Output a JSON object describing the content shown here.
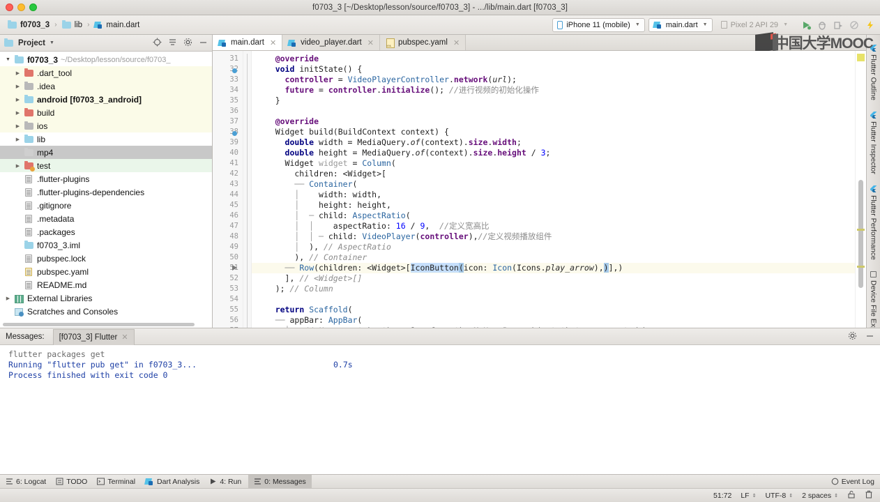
{
  "window": {
    "title": "f0703_3 [~/Desktop/lesson/source/f0703_3] - .../lib/main.dart [f0703_3]"
  },
  "toolbar": {
    "breadcrumbs": [
      {
        "label": "f0703_3",
        "icon": "project-icon"
      },
      {
        "label": "lib",
        "icon": "folder-icon"
      },
      {
        "label": "main.dart",
        "icon": "dart-file-icon"
      }
    ],
    "breadcrumb_separator": "›",
    "device_selector": "iPhone 11 (mobile)",
    "run_config": "main.dart",
    "android_device": "Pixel 2 API 29",
    "icons": [
      "run-icon",
      "debug-icon",
      "profile-icon",
      "coverage-icon",
      "hot-reload-icon"
    ]
  },
  "watermark": {
    "text": "中国大学MOOC"
  },
  "project_panel": {
    "title": "Project",
    "header_icons": [
      "locate-icon",
      "collapse-all-icon",
      "settings-gear-icon",
      "minimize-icon"
    ],
    "tree": [
      {
        "label": "f0703_3",
        "path": "~/Desktop/lesson/source/f0703_",
        "indent": 0,
        "arrow": "open",
        "icon": "project-folder-icon",
        "bold": true,
        "bg": "none"
      },
      {
        "label": ".dart_tool",
        "indent": 1,
        "arrow": "closed",
        "icon": "folder-red-icon",
        "bg": "yellow"
      },
      {
        "label": ".idea",
        "indent": 1,
        "arrow": "closed",
        "icon": "folder-gray-icon",
        "bg": "yellow"
      },
      {
        "label": "android [f0703_3_android]",
        "indent": 1,
        "arrow": "closed",
        "icon": "module-folder-icon",
        "bold": true,
        "bg": "yellow"
      },
      {
        "label": "build",
        "indent": 1,
        "arrow": "closed",
        "icon": "folder-red-icon",
        "bg": "yellow"
      },
      {
        "label": "ios",
        "indent": 1,
        "arrow": "closed",
        "icon": "folder-gray-icon",
        "bg": "yellow"
      },
      {
        "label": "lib",
        "indent": 1,
        "arrow": "closed",
        "icon": "folder-blue-icon",
        "bg": "none"
      },
      {
        "label": "mp4",
        "indent": 1,
        "arrow": "none",
        "icon": "folder-lgray-icon",
        "bg": "selected"
      },
      {
        "label": "test",
        "indent": 1,
        "arrow": "closed",
        "icon": "folder-test-icon",
        "bg": "green"
      },
      {
        "label": ".flutter-plugins",
        "indent": 1,
        "arrow": "none",
        "icon": "file-icon",
        "bg": "none"
      },
      {
        "label": ".flutter-plugins-dependencies",
        "indent": 1,
        "arrow": "none",
        "icon": "file-icon",
        "bg": "none"
      },
      {
        "label": ".gitignore",
        "indent": 1,
        "arrow": "none",
        "icon": "file-icon",
        "bg": "none"
      },
      {
        "label": ".metadata",
        "indent": 1,
        "arrow": "none",
        "icon": "file-icon",
        "bg": "none"
      },
      {
        "label": ".packages",
        "indent": 1,
        "arrow": "none",
        "icon": "file-icon",
        "bg": "none"
      },
      {
        "label": "f0703_3.iml",
        "indent": 1,
        "arrow": "none",
        "icon": "iml-file-icon",
        "bg": "none"
      },
      {
        "label": "pubspec.lock",
        "indent": 1,
        "arrow": "none",
        "icon": "file-icon",
        "bg": "none"
      },
      {
        "label": "pubspec.yaml",
        "indent": 1,
        "arrow": "none",
        "icon": "yaml-file-icon",
        "bg": "none"
      },
      {
        "label": "README.md",
        "indent": 1,
        "arrow": "none",
        "icon": "file-icon",
        "bg": "none"
      },
      {
        "label": "External Libraries",
        "indent": 0,
        "arrow": "closed",
        "icon": "libraries-icon",
        "bg": "none"
      },
      {
        "label": "Scratches and Consoles",
        "indent": 0,
        "arrow": "none",
        "icon": "scratches-icon",
        "bg": "none"
      }
    ]
  },
  "editor": {
    "tabs": [
      {
        "label": "main.dart",
        "icon": "dart-file-icon",
        "active": true
      },
      {
        "label": "video_player.dart",
        "icon": "dart-file-icon",
        "active": false
      },
      {
        "label": "pubspec.yaml",
        "icon": "yaml-file-icon",
        "active": false
      }
    ],
    "first_line": 31,
    "current_line": 51,
    "lines": [
      {
        "n": 31,
        "html": "    <span class=\"fld\">@override</span>"
      },
      {
        "n": 32,
        "gutter": "override-marker",
        "html": "    <span class=\"k\">void</span> initState() {"
      },
      {
        "n": 33,
        "html": "      <span class=\"fld\">controller</span> = <span class=\"t\">VideoPlayerController</span>.<span class=\"fld\">network</span>(<span class=\"prm\">url</span>);"
      },
      {
        "n": 34,
        "html": "      <span class=\"fld\">future</span> = <span class=\"fld\">controller</span>.<span class=\"fld\">initialize</span>(); <span class=\"cm\">//</span><span class=\"cmz\">进行视频的初始化操作</span>"
      },
      {
        "n": 35,
        "fold": "end",
        "html": "    }"
      },
      {
        "n": 36,
        "html": ""
      },
      {
        "n": 37,
        "html": "    <span class=\"fld\">@override</span>"
      },
      {
        "n": 38,
        "gutter": "override-marker",
        "html": "    Widget build(BuildContext context) {"
      },
      {
        "n": 39,
        "html": "      <span class=\"k\">double</span> width = MediaQuery.<span class=\"prm\">of</span>(context).<span class=\"fld\">size</span>.<span class=\"fld\">width</span>;"
      },
      {
        "n": 40,
        "html": "      <span class=\"k\">double</span> height = MediaQuery.<span class=\"prm\">of</span>(context).<span class=\"fld\">size</span>.<span class=\"fld\">height</span> / <span class=\"num\">3</span>;"
      },
      {
        "n": 41,
        "html": "      Widget <span class=\"tree-line\">widget</span> = <span class=\"t\">Column</span>("
      },
      {
        "n": 42,
        "html": "        children: &lt;Widget&gt;["
      },
      {
        "n": 43,
        "html": "        <span class=\"tree-line\">──</span> <span class=\"t\">Container</span>("
      },
      {
        "n": 44,
        "html": "        <span class=\"tree-line\">│</span>    width: width,"
      },
      {
        "n": 45,
        "html": "        <span class=\"tree-line\">│</span>    height: height,"
      },
      {
        "n": 46,
        "html": "        <span class=\"tree-line\">│</span>  <span class=\"tree-line\">─</span> child: <span class=\"t\">AspectRatio</span>("
      },
      {
        "n": 47,
        "html": "        <span class=\"tree-line\">│  │</span>    aspectRatio: <span class=\"num\">16</span> / <span class=\"num\">9</span>,  <span class=\"cm\">//</span><span class=\"cmz\">定义宽高比</span>"
      },
      {
        "n": 48,
        "html": "        <span class=\"tree-line\">│  │</span> <span class=\"tree-line\">─</span> child: <span class=\"t\">VideoPlayer</span>(<span class=\"fld\">controller</span>),<span class=\"cm\">//</span><span class=\"cmz\">定义视频播放组件</span>"
      },
      {
        "n": 49,
        "html": "        <span class=\"tree-line\">│</span>  ), <span class=\"cm\">// AspectRatio</span>"
      },
      {
        "n": 50,
        "html": "        ), <span class=\"cm\">// Container</span>"
      },
      {
        "n": 51,
        "current": true,
        "gutter": "run-marker",
        "html": "      <span class=\"tree-line\">──</span> <span class=\"t\">Row</span>(children: &lt;Widget&gt;[<span class=\"hl\">IconButton</span><span class=\"sel\">(</span>icon: <span class=\"t\">Icon</span>(Icons.<span class=\"prm\">play_arrow</span>),<span class=\"sel\">)</span>],)"
      },
      {
        "n": 52,
        "html": "      ], <span class=\"cm\">// &lt;Widget&gt;[]</span>"
      },
      {
        "n": 53,
        "html": "    ); <span class=\"cm\">// Column</span>"
      },
      {
        "n": 54,
        "html": ""
      },
      {
        "n": 55,
        "html": "    <span class=\"k\">return</span> <span class=\"t\">Scaffold</span>("
      },
      {
        "n": 56,
        "html": "    <span class=\"tree-line\">──</span> appBar: <span class=\"t\">AppBar</span>("
      },
      {
        "n": 57,
        "html": "      <span class=\"tree-line\">│</span>   <span class=\"cm\">// Here we take the value from the MyHomePage object that was created by</span>"
      }
    ]
  },
  "messages_panel": {
    "label": "Messages:",
    "tab": "[f0703_3] Flutter",
    "header_icons": [
      "settings-gear-icon",
      "minimize-icon"
    ],
    "lines": [
      {
        "text": "flutter packages get",
        "style": "gray"
      },
      {
        "text": "Running \"flutter pub get\" in f0703_3...",
        "style": "blue",
        "time": "0.7s"
      },
      {
        "text": "Process finished with exit code 0",
        "style": "blue"
      }
    ]
  },
  "status_bar": {
    "items": [
      {
        "label": "6: Logcat",
        "accel": "6",
        "icon": "logcat-icon",
        "active": false
      },
      {
        "label": "TODO",
        "icon": "todo-icon",
        "active": false
      },
      {
        "label": "Terminal",
        "icon": "terminal-icon",
        "active": false
      },
      {
        "label": "Dart Analysis",
        "icon": "dart-analysis-icon",
        "active": false
      },
      {
        "label": "4: Run",
        "accel": "4",
        "icon": "run-icon",
        "active": false
      },
      {
        "label": "0: Messages",
        "accel": "0",
        "icon": "messages-icon",
        "active": true
      }
    ],
    "event_log": "Event Log"
  },
  "bottom_bar": {
    "caret_position": "51:72",
    "line_separator": "LF",
    "encoding": "UTF-8",
    "indent": "2 spaces",
    "icons": [
      "lock-open-icon",
      "trash-icon"
    ]
  },
  "right_strip": {
    "tabs": [
      {
        "label": "Flutter Outline",
        "icon": "flutter-icon"
      },
      {
        "label": "Flutter Inspector",
        "icon": "flutter-icon"
      },
      {
        "label": "Flutter Performance",
        "icon": "flutter-icon"
      },
      {
        "label": "Device File Explorer",
        "icon": "device-icon"
      }
    ]
  },
  "colors": {
    "accent": "#4a9fd4",
    "selection": "#a6c9e8",
    "current_line": "#fcfaec",
    "keyword": "#000080",
    "type": "#2a65a0",
    "comment": "#8c8c8c"
  }
}
